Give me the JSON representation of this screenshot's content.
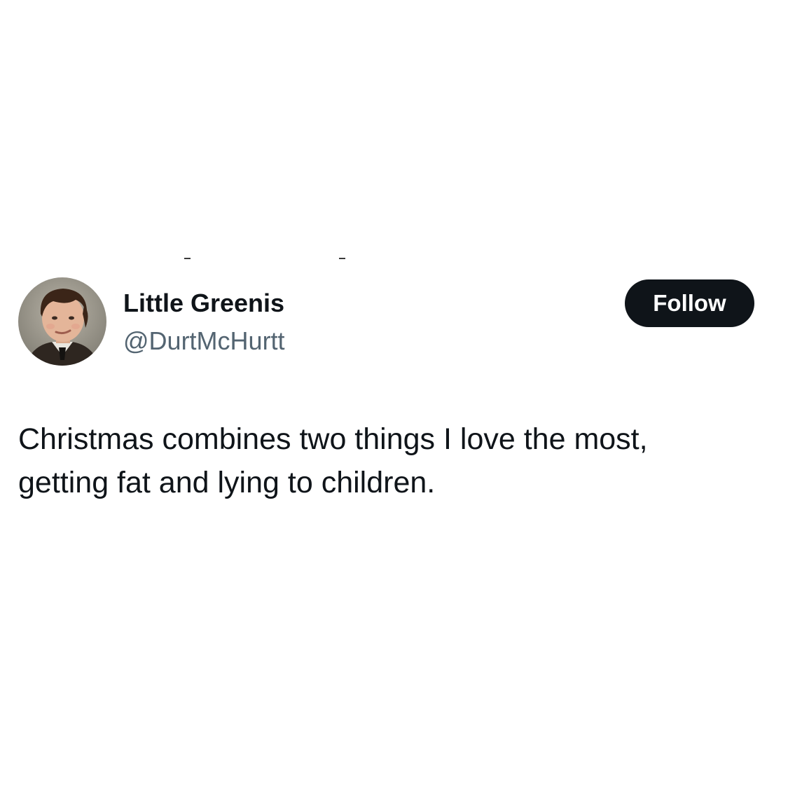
{
  "tweet": {
    "author": {
      "display_name": "Little Greenis",
      "handle": "@DurtMcHurtt",
      "avatar_icon": "profile-photo"
    },
    "follow_label": "Follow",
    "text_lines": [
      "Christmas combines two things I love the most,",
      "getting fat and lying to children."
    ]
  },
  "colors": {
    "background": "#ffffff",
    "text_primary": "#0f1419",
    "text_secondary": "#536471",
    "button_bg": "#0f1419",
    "button_text": "#ffffff"
  }
}
